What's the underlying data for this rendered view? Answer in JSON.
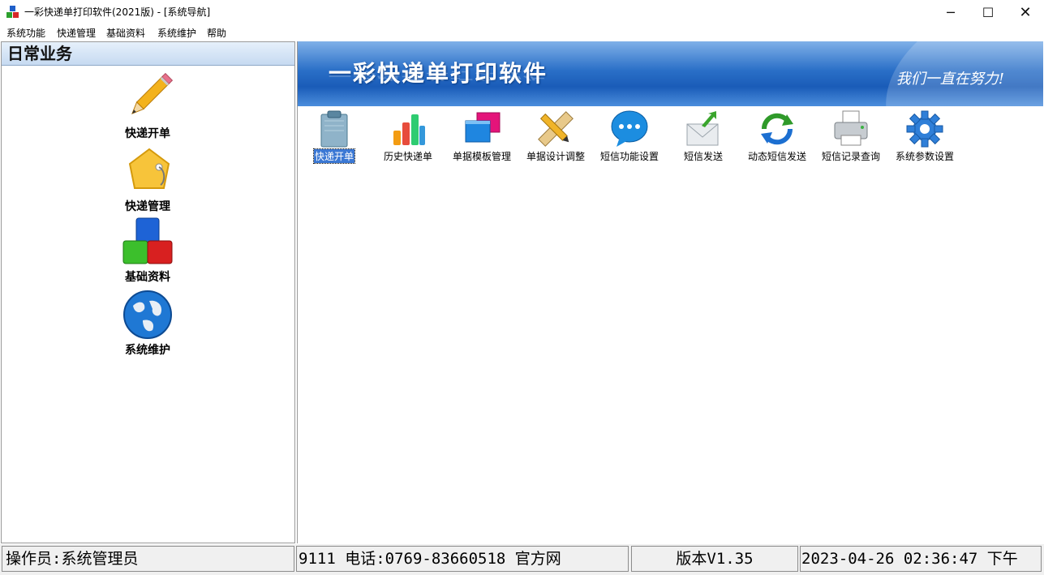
{
  "window": {
    "title": "一彩快递单打印软件(2021版) - [系统导航]",
    "minimize_glyph": "─",
    "maximize_glyph": "☐",
    "close_glyph": "✕"
  },
  "menu": [
    "系统功能",
    "快递管理",
    "基础资料",
    "系统维护",
    "帮助"
  ],
  "left_panel": {
    "header": "日常业务",
    "items": [
      {
        "label": "快递开单",
        "icon": "pencil-icon"
      },
      {
        "label": "快递管理",
        "icon": "tag-icon"
      },
      {
        "label": "基础资料",
        "icon": "blocks-icon"
      },
      {
        "label": "系统维护",
        "icon": "globe-icon"
      }
    ]
  },
  "banner": {
    "title": "一彩快递单打印软件",
    "slogan": "我们一直在努力!"
  },
  "toolbar": [
    {
      "label": "快递开单",
      "icon": "clipboard-icon",
      "selected": true
    },
    {
      "label": "历史快递单",
      "icon": "bar-chart-icon"
    },
    {
      "label": "单据模板管理",
      "icon": "windows-icon"
    },
    {
      "label": "单据设计调整",
      "icon": "ruler-pencil-icon"
    },
    {
      "label": "短信功能设置",
      "icon": "chat-bubble-icon"
    },
    {
      "label": "短信发送",
      "icon": "envelope-send-icon"
    },
    {
      "label": "动态短信发送",
      "icon": "refresh-icon"
    },
    {
      "label": "短信记录查询",
      "icon": "printer-icon"
    },
    {
      "label": "系统参数设置",
      "icon": "gear-icon"
    }
  ],
  "status": {
    "operator": "操作员:系统管理员",
    "contact": "9111   电话:0769-83660518   官方网",
    "version": "版本V1.35",
    "datetime": "2023-04-26 02:36:47 下午"
  },
  "colors": {
    "banner": "#2a6fc7",
    "header": "#c6daf1",
    "selection": "#3b78d4"
  }
}
